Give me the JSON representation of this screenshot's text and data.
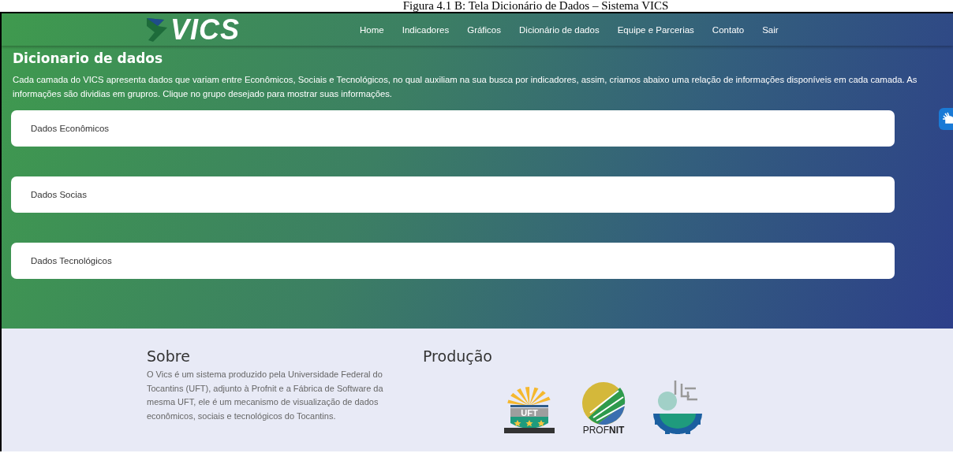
{
  "caption": "Figura 4.1 B: Tela Dicionário de Dados – Sistema VICS",
  "navbar": {
    "logo_text": "VICS",
    "links": [
      {
        "label": "Home"
      },
      {
        "label": "Indicadores"
      },
      {
        "label": "Gráficos"
      },
      {
        "label": "Dicionário de dados"
      },
      {
        "label": "Equipe e Parcerias"
      },
      {
        "label": "Contato"
      },
      {
        "label": "Sair"
      }
    ]
  },
  "page": {
    "title": "Dicionario de dados",
    "description": "Cada camada do VICS apresenta dados que variam entre Econômicos, Sociais e Tecnológicos, no qual auxiliam na sua busca por indicadores, assim, criamos abaixo uma relação de informações disponíveis em cada camada. As informações são dividias em grupros. Clique no grupo desejado para mostrar suas informações.",
    "groups": [
      {
        "label": "Dados Econômicos",
        "expanded": false
      },
      {
        "label": "Dados Socias",
        "expanded": false
      },
      {
        "label": "Dados Tecnológicos",
        "expanded": false
      }
    ]
  },
  "footer": {
    "about_title": "Sobre",
    "about_text": "O Vics é um sistema produzido pela Universidade Federal do Tocantins (UFT), adjunto à Profnit e a Fábrica de Software da mesma UFT, ele é um mecanismo de visualização de dados econômicos, sociais e tecnológicos do Tocantins.",
    "production_title": "Produção",
    "logos": [
      {
        "kind": "uft",
        "text": "UFT"
      },
      {
        "kind": "profnit",
        "text": "PROF",
        "bold_text": "NIT"
      },
      {
        "kind": "factory"
      }
    ]
  }
}
